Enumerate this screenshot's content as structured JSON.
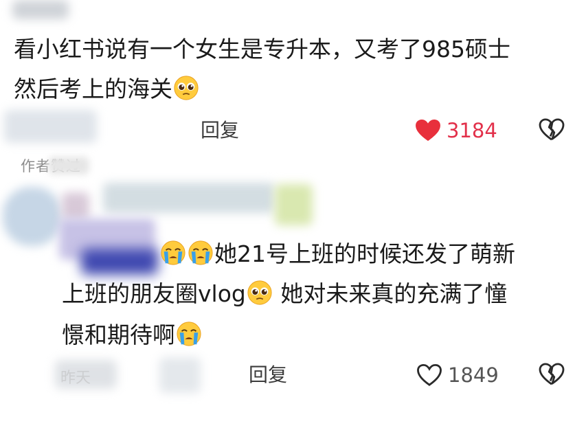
{
  "comment1": {
    "line1": "看小红书说有一个女生是专升本，又考了985硕士",
    "line2": "然后考上的海关",
    "reply_label": "回复",
    "like_count": "3184",
    "like_color": "#e8303c"
  },
  "author_tag": "作者赞过",
  "comment2": {
    "line1": "她21号上班的时候还发了萌新",
    "line2_a": "上班的朋友圈vlog",
    "line2_b": " 她对未来真的充满了憧",
    "line3": "憬和期待啊",
    "reply_label": "回复",
    "like_count": "1849",
    "time_label": "昨天"
  },
  "icons": {
    "pleading_face": "pleading-face-icon",
    "crying_face": "loudly-crying-face-icon",
    "heart_filled": "heart-filled-icon",
    "heart_outline": "heart-outline-icon",
    "dislike": "broken-heart-icon"
  }
}
